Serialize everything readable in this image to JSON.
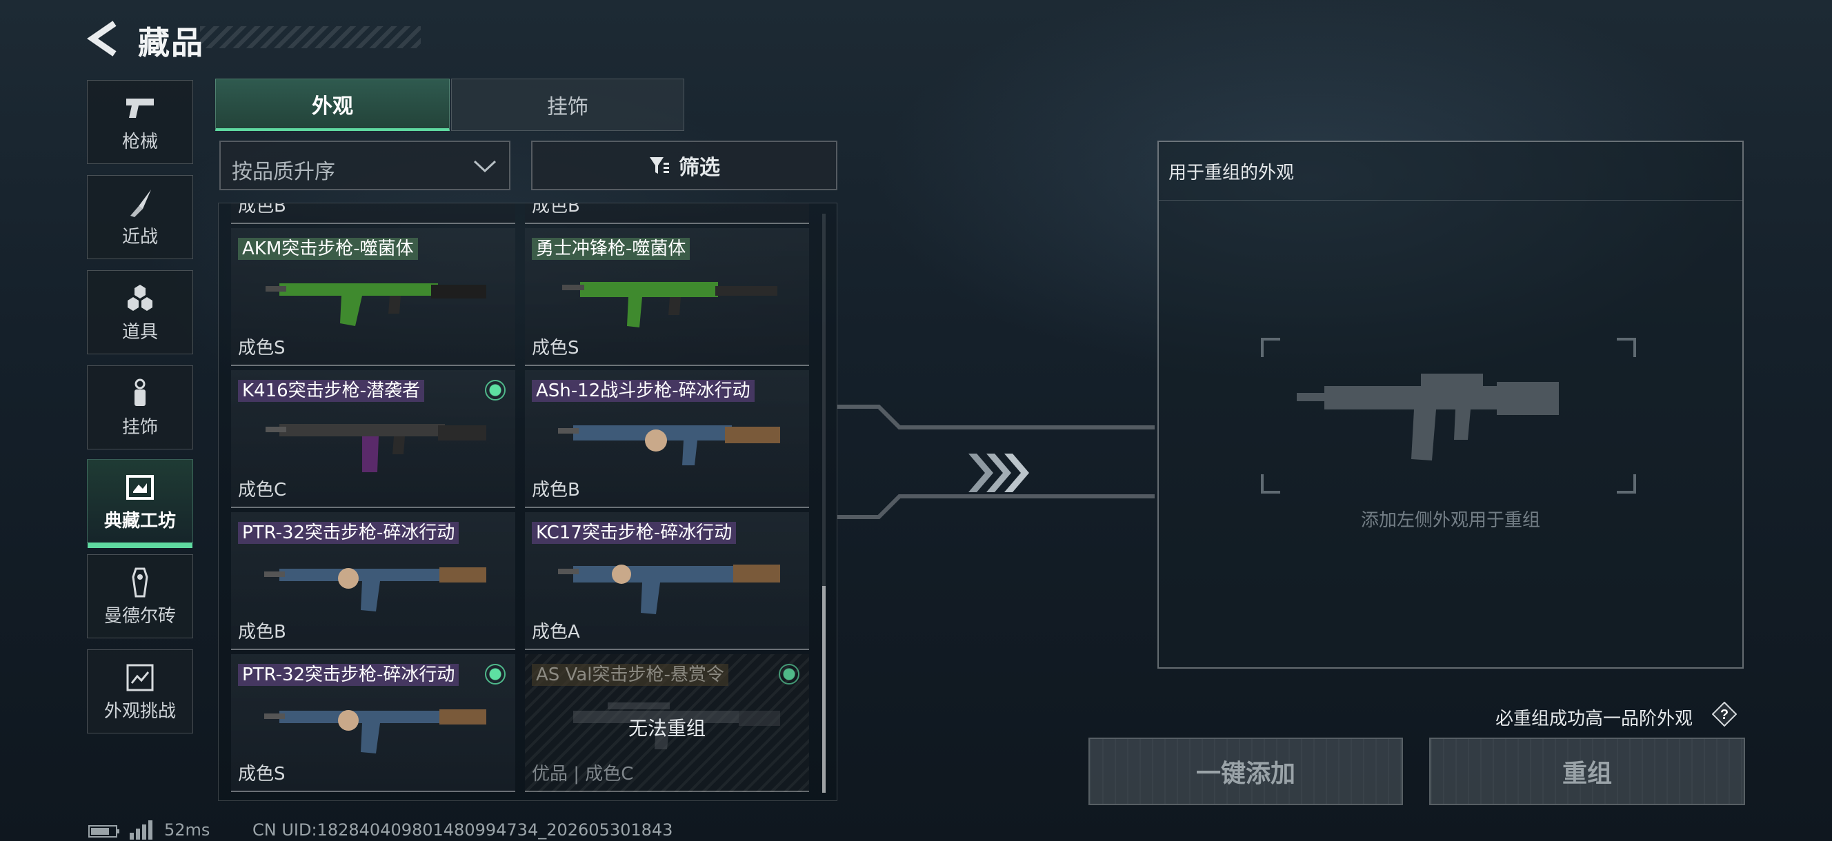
{
  "header": {
    "title": "藏品"
  },
  "nav": [
    {
      "label": "枪械",
      "icon": "pistol-icon"
    },
    {
      "label": "近战",
      "icon": "knife-icon"
    },
    {
      "label": "道具",
      "icon": "grenade-icon"
    },
    {
      "label": "挂饰",
      "icon": "keychain-icon"
    },
    {
      "label": "典藏工坊",
      "icon": "workshop-icon",
      "active": true
    },
    {
      "label": "曼德尔砖",
      "icon": "mandel-brick-icon"
    },
    {
      "label": "外观挑战",
      "icon": "challenge-icon"
    }
  ],
  "tabs": [
    {
      "label": "外观",
      "active": true
    },
    {
      "label": "挂饰",
      "active": false
    }
  ],
  "sort": {
    "label": "按品质升序"
  },
  "filter": {
    "label": "筛选"
  },
  "grid": {
    "cut_labels": [
      "成色B",
      "成色B"
    ],
    "items": [
      {
        "name": "AKM突击步枪-噬菌体",
        "grade": "成色S",
        "tag": "green",
        "selected": false
      },
      {
        "name": "勇士冲锋枪-噬菌体",
        "grade": "成色S",
        "tag": "green",
        "selected": false
      },
      {
        "name": "K416突击步枪-潜袭者",
        "grade": "成色C",
        "tag": "purple",
        "selected": true
      },
      {
        "name": "ASh-12战斗步枪-碎冰行动",
        "grade": "成色B",
        "tag": "purple",
        "selected": false
      },
      {
        "name": "PTR-32突击步枪-碎冰行动",
        "grade": "成色B",
        "tag": "purple",
        "selected": false
      },
      {
        "name": "KC17突击步枪-碎冰行动",
        "grade": "成色A",
        "tag": "purple",
        "selected": false
      },
      {
        "name": "PTR-32突击步枪-碎冰行动",
        "grade": "成色S",
        "tag": "purple",
        "selected": true
      },
      {
        "name": "AS Val突击步枪-悬赏令",
        "grade": "优品 | 成色C",
        "tag": "dim",
        "selected": true,
        "locked": true,
        "locked_text": "无法重组"
      }
    ]
  },
  "recombine": {
    "title": "用于重组的外观",
    "placeholder": "添加左侧外观用于重组"
  },
  "guarantee_text": "必重组成功高一品阶外观",
  "buttons": {
    "add_all": "一键添加",
    "recombine": "重组"
  },
  "footer": {
    "ping": "52ms",
    "uid": "CN UID:182840409801480994734_202605301843"
  },
  "colors": {
    "accent": "#5fd9a0",
    "tab_active": "#2f5a4f",
    "tag_green": "#466e50",
    "tag_purple": "#503c6e"
  }
}
